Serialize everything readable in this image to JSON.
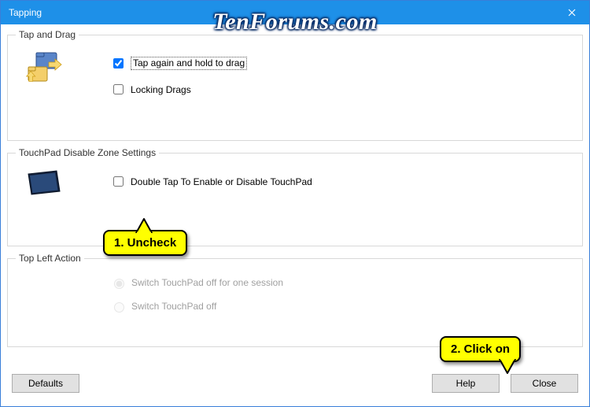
{
  "titlebar": {
    "title": "Tapping"
  },
  "group1": {
    "legend": "Tap and Drag",
    "opt1": {
      "label": "Tap again and hold to drag",
      "checked": true
    },
    "opt2": {
      "label": "Locking Drags",
      "checked": false
    }
  },
  "group2": {
    "legend": "TouchPad Disable Zone Settings",
    "opt1": {
      "label": "Double Tap To Enable or Disable TouchPad",
      "checked": false
    }
  },
  "group3": {
    "legend": "Top Left Action",
    "opt1": {
      "label": "Switch TouchPad off for one session",
      "selected": true,
      "enabled": false
    },
    "opt2": {
      "label": "Switch TouchPad off",
      "selected": false,
      "enabled": false
    }
  },
  "buttons": {
    "defaults": "Defaults",
    "help": "Help",
    "close": "Close"
  },
  "callouts": {
    "c1": "1. Uncheck",
    "c2": "2. Click on"
  },
  "watermark": "TenForums.com"
}
